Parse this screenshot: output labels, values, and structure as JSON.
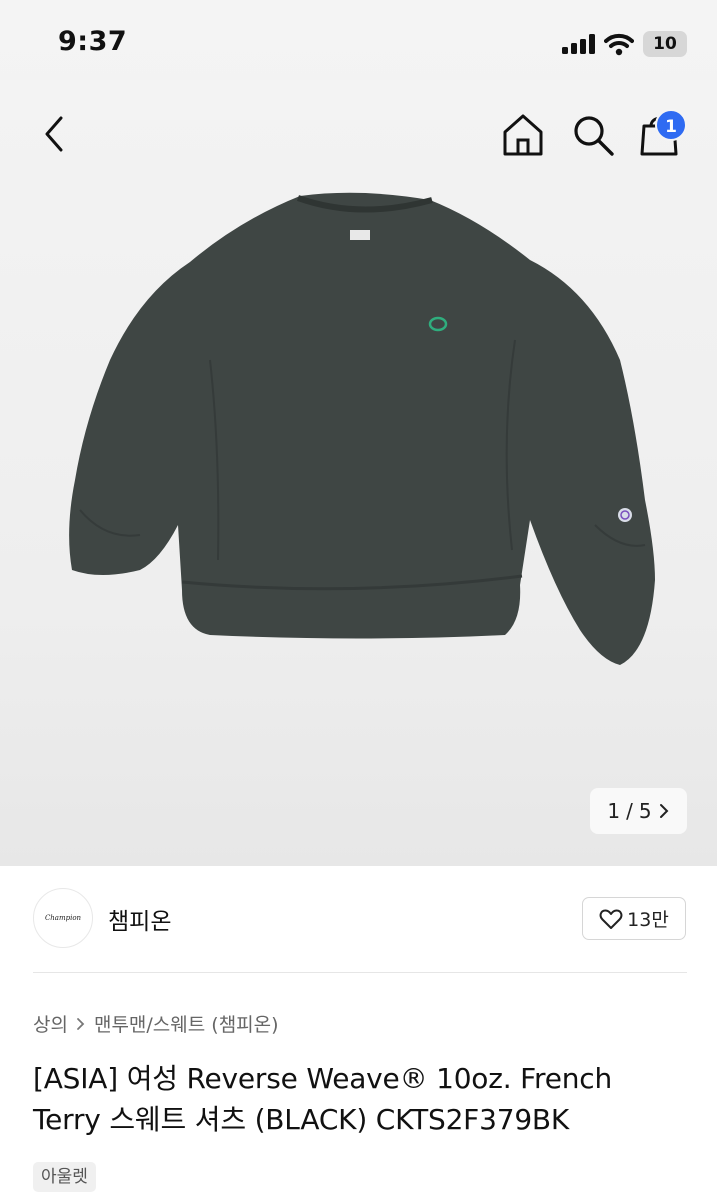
{
  "status_bar": {
    "time": "9:37",
    "battery": "10"
  },
  "header": {
    "cart_count": "1"
  },
  "gallery": {
    "current": "1",
    "separator": "/",
    "total": "5"
  },
  "brand": {
    "name": "챔피온",
    "logo_text": "Champion",
    "likes": "13만"
  },
  "breadcrumb": {
    "category": "상의",
    "subcategory": "맨투맨/스웨트 (챔피온)"
  },
  "product": {
    "title_line1": "[ASIA] 여성 Reverse Weave® 10oz. French",
    "title_line2": "Terry 스웨트 셔츠 (BLACK) CKTS2F379BK",
    "tag": "아울렛"
  },
  "colors": {
    "accent": "#2f6bf2",
    "garment": "#3f4644",
    "logo_green": "#2fae7e"
  }
}
